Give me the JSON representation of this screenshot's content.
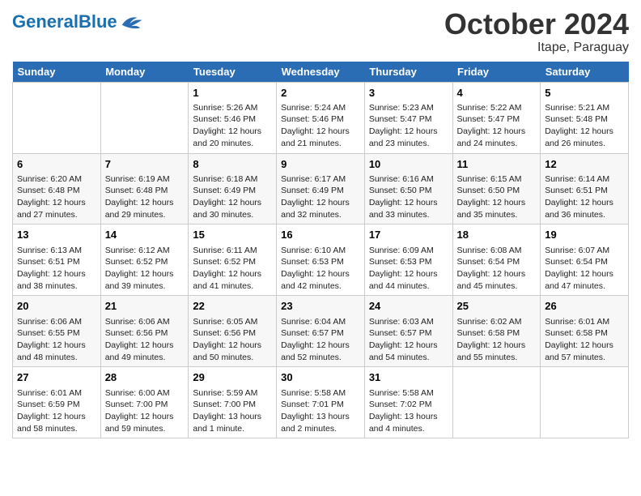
{
  "header": {
    "logo_general": "General",
    "logo_blue": "Blue",
    "month_title": "October 2024",
    "location": "Itape, Paraguay"
  },
  "weekdays": [
    "Sunday",
    "Monday",
    "Tuesday",
    "Wednesday",
    "Thursday",
    "Friday",
    "Saturday"
  ],
  "weeks": [
    [
      {
        "day": null
      },
      {
        "day": null
      },
      {
        "day": "1",
        "sunrise": "Sunrise: 5:26 AM",
        "sunset": "Sunset: 5:46 PM",
        "daylight": "Daylight: 12 hours and 20 minutes."
      },
      {
        "day": "2",
        "sunrise": "Sunrise: 5:24 AM",
        "sunset": "Sunset: 5:46 PM",
        "daylight": "Daylight: 12 hours and 21 minutes."
      },
      {
        "day": "3",
        "sunrise": "Sunrise: 5:23 AM",
        "sunset": "Sunset: 5:47 PM",
        "daylight": "Daylight: 12 hours and 23 minutes."
      },
      {
        "day": "4",
        "sunrise": "Sunrise: 5:22 AM",
        "sunset": "Sunset: 5:47 PM",
        "daylight": "Daylight: 12 hours and 24 minutes."
      },
      {
        "day": "5",
        "sunrise": "Sunrise: 5:21 AM",
        "sunset": "Sunset: 5:48 PM",
        "daylight": "Daylight: 12 hours and 26 minutes."
      }
    ],
    [
      {
        "day": "6",
        "sunrise": "Sunrise: 6:20 AM",
        "sunset": "Sunset: 6:48 PM",
        "daylight": "Daylight: 12 hours and 27 minutes."
      },
      {
        "day": "7",
        "sunrise": "Sunrise: 6:19 AM",
        "sunset": "Sunset: 6:48 PM",
        "daylight": "Daylight: 12 hours and 29 minutes."
      },
      {
        "day": "8",
        "sunrise": "Sunrise: 6:18 AM",
        "sunset": "Sunset: 6:49 PM",
        "daylight": "Daylight: 12 hours and 30 minutes."
      },
      {
        "day": "9",
        "sunrise": "Sunrise: 6:17 AM",
        "sunset": "Sunset: 6:49 PM",
        "daylight": "Daylight: 12 hours and 32 minutes."
      },
      {
        "day": "10",
        "sunrise": "Sunrise: 6:16 AM",
        "sunset": "Sunset: 6:50 PM",
        "daylight": "Daylight: 12 hours and 33 minutes."
      },
      {
        "day": "11",
        "sunrise": "Sunrise: 6:15 AM",
        "sunset": "Sunset: 6:50 PM",
        "daylight": "Daylight: 12 hours and 35 minutes."
      },
      {
        "day": "12",
        "sunrise": "Sunrise: 6:14 AM",
        "sunset": "Sunset: 6:51 PM",
        "daylight": "Daylight: 12 hours and 36 minutes."
      }
    ],
    [
      {
        "day": "13",
        "sunrise": "Sunrise: 6:13 AM",
        "sunset": "Sunset: 6:51 PM",
        "daylight": "Daylight: 12 hours and 38 minutes."
      },
      {
        "day": "14",
        "sunrise": "Sunrise: 6:12 AM",
        "sunset": "Sunset: 6:52 PM",
        "daylight": "Daylight: 12 hours and 39 minutes."
      },
      {
        "day": "15",
        "sunrise": "Sunrise: 6:11 AM",
        "sunset": "Sunset: 6:52 PM",
        "daylight": "Daylight: 12 hours and 41 minutes."
      },
      {
        "day": "16",
        "sunrise": "Sunrise: 6:10 AM",
        "sunset": "Sunset: 6:53 PM",
        "daylight": "Daylight: 12 hours and 42 minutes."
      },
      {
        "day": "17",
        "sunrise": "Sunrise: 6:09 AM",
        "sunset": "Sunset: 6:53 PM",
        "daylight": "Daylight: 12 hours and 44 minutes."
      },
      {
        "day": "18",
        "sunrise": "Sunrise: 6:08 AM",
        "sunset": "Sunset: 6:54 PM",
        "daylight": "Daylight: 12 hours and 45 minutes."
      },
      {
        "day": "19",
        "sunrise": "Sunrise: 6:07 AM",
        "sunset": "Sunset: 6:54 PM",
        "daylight": "Daylight: 12 hours and 47 minutes."
      }
    ],
    [
      {
        "day": "20",
        "sunrise": "Sunrise: 6:06 AM",
        "sunset": "Sunset: 6:55 PM",
        "daylight": "Daylight: 12 hours and 48 minutes."
      },
      {
        "day": "21",
        "sunrise": "Sunrise: 6:06 AM",
        "sunset": "Sunset: 6:56 PM",
        "daylight": "Daylight: 12 hours and 49 minutes."
      },
      {
        "day": "22",
        "sunrise": "Sunrise: 6:05 AM",
        "sunset": "Sunset: 6:56 PM",
        "daylight": "Daylight: 12 hours and 50 minutes."
      },
      {
        "day": "23",
        "sunrise": "Sunrise: 6:04 AM",
        "sunset": "Sunset: 6:57 PM",
        "daylight": "Daylight: 12 hours and 52 minutes."
      },
      {
        "day": "24",
        "sunrise": "Sunrise: 6:03 AM",
        "sunset": "Sunset: 6:57 PM",
        "daylight": "Daylight: 12 hours and 54 minutes."
      },
      {
        "day": "25",
        "sunrise": "Sunrise: 6:02 AM",
        "sunset": "Sunset: 6:58 PM",
        "daylight": "Daylight: 12 hours and 55 minutes."
      },
      {
        "day": "26",
        "sunrise": "Sunrise: 6:01 AM",
        "sunset": "Sunset: 6:58 PM",
        "daylight": "Daylight: 12 hours and 57 minutes."
      }
    ],
    [
      {
        "day": "27",
        "sunrise": "Sunrise: 6:01 AM",
        "sunset": "Sunset: 6:59 PM",
        "daylight": "Daylight: 12 hours and 58 minutes."
      },
      {
        "day": "28",
        "sunrise": "Sunrise: 6:00 AM",
        "sunset": "Sunset: 7:00 PM",
        "daylight": "Daylight: 12 hours and 59 minutes."
      },
      {
        "day": "29",
        "sunrise": "Sunrise: 5:59 AM",
        "sunset": "Sunset: 7:00 PM",
        "daylight": "Daylight: 13 hours and 1 minute."
      },
      {
        "day": "30",
        "sunrise": "Sunrise: 5:58 AM",
        "sunset": "Sunset: 7:01 PM",
        "daylight": "Daylight: 13 hours and 2 minutes."
      },
      {
        "day": "31",
        "sunrise": "Sunrise: 5:58 AM",
        "sunset": "Sunset: 7:02 PM",
        "daylight": "Daylight: 13 hours and 4 minutes."
      },
      {
        "day": null
      },
      {
        "day": null
      }
    ]
  ]
}
